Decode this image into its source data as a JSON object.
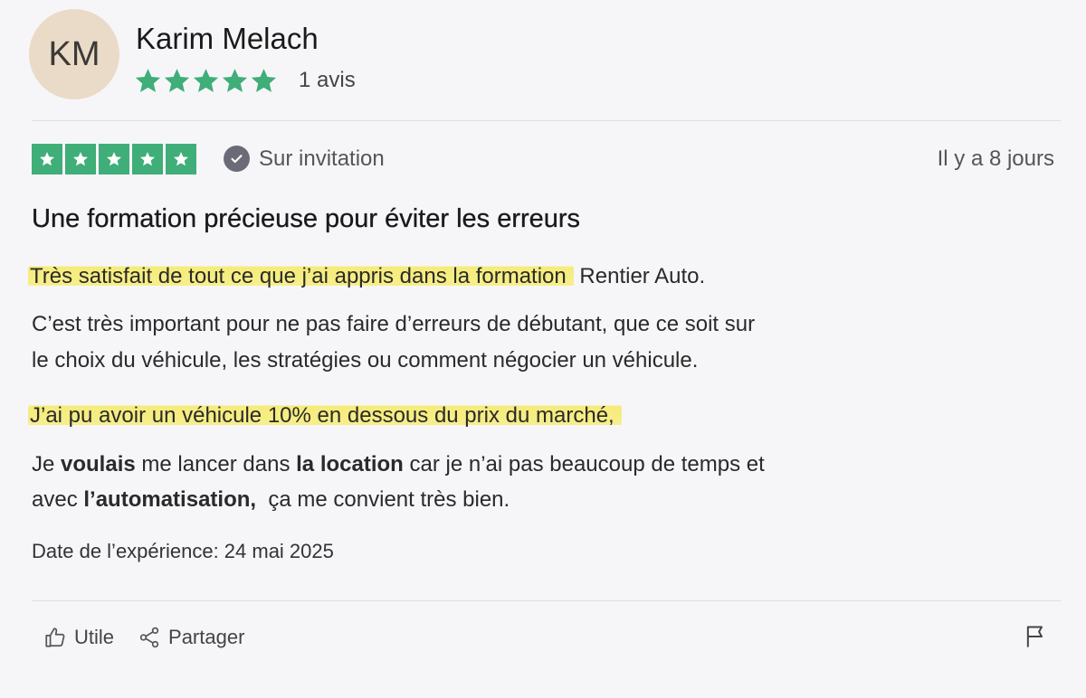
{
  "reviewer": {
    "initials": "KM",
    "name": "Karim Melach",
    "review_count": "1 avis",
    "profile_stars": 5
  },
  "review": {
    "rating": 5,
    "star_color": "#3fae78",
    "invitation_label": "Sur invitation",
    "time_ago": "Il y a 8 jours",
    "title": "Une formation précieuse pour éviter les erreurs",
    "highlight_1": "Très satisfait de tout ce que j’ai appris dans la formation",
    "line_1_rest": " Rentier Auto.",
    "para_2_line_1": "C’est très important pour ne pas faire d’erreurs de débutant, que ce soit sur",
    "para_2_line_2": "le choix du véhicule, les stratégies ou comment négocier un véhicule.",
    "highlight_2": "J’ai pu avoir un véhicule 10% en dessous du prix du marché,",
    "para_4_a": "Je ",
    "para_4_b": "voulais",
    "para_4_c": " me lancer dans ",
    "para_4_d": "la location",
    "para_4_e": " car je n’ai pas beaucoup de temps et",
    "para_5_a": "avec ",
    "para_5_b": "l’automatisation,",
    "para_5_c": "  ça me convient très bien.",
    "experience_date": "Date de l’expérience: 24 mai 2025",
    "highlight_color": "#f5ec7b"
  },
  "actions": {
    "useful_label": "Utile",
    "share_label": "Partager",
    "useful_icon": "thumbs-up-icon",
    "share_icon": "share-icon",
    "report_icon": "flag-icon"
  }
}
